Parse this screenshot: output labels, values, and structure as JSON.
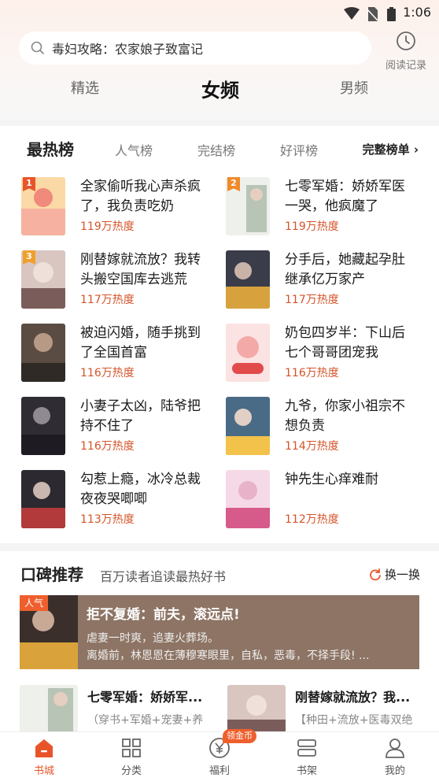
{
  "status_bar": {
    "time": "1:06",
    "icons": [
      "wifi-icon",
      "no-sim-icon",
      "battery-icon"
    ]
  },
  "search": {
    "placeholder": "毒妇攻略：农家娘子致富记",
    "icon": "search-icon"
  },
  "history": {
    "label": "阅读记录",
    "icon": "clock-icon"
  },
  "top_tabs": [
    {
      "label": "精选",
      "active": false
    },
    {
      "label": "女频",
      "active": true
    },
    {
      "label": "男频",
      "active": false
    }
  ],
  "ranking": {
    "title": "最热榜",
    "tabs": [
      "人气榜",
      "完结榜",
      "好评榜"
    ],
    "full_list": "完整榜单 ›",
    "books": [
      {
        "rank": "1",
        "title": "全家偷听我心声杀疯了，我负责吃奶",
        "heat": "119万热度"
      },
      {
        "rank": "2",
        "title": "七零军婚：娇娇军医一哭，他疯魔了",
        "heat": "119万热度"
      },
      {
        "rank": "3",
        "title": "刚替嫁就流放？我转头搬空国库去逃荒",
        "heat": "117万热度"
      },
      {
        "rank": "",
        "title": "分手后，她藏起孕肚继承亿万家产",
        "heat": "117万热度"
      },
      {
        "rank": "",
        "title": "被迫闪婚，随手挑到了全国首富",
        "heat": "116万热度"
      },
      {
        "rank": "",
        "title": "奶包四岁半：下山后七个哥哥团宠我",
        "heat": "116万热度"
      },
      {
        "rank": "",
        "title": "小妻子太凶，陆爷把持不住了",
        "heat": "116万热度"
      },
      {
        "rank": "",
        "title": "九爷，你家小祖宗不想负责",
        "heat": "114万热度"
      },
      {
        "rank": "",
        "title": "勾惹上瘾，冰冷总裁夜夜哭唧唧",
        "heat": "113万热度"
      },
      {
        "rank": "",
        "title": "钟先生心痒难耐",
        "heat": "112万热度"
      }
    ]
  },
  "recommend": {
    "title": "口碑推荐",
    "subtitle": "百万读者追读最热好书",
    "refresh": "换一换",
    "banner": {
      "tag": "人气",
      "title": "拒不复婚：前夫，滚远点!",
      "desc1": "虐妻一时爽，追妻火葬场。",
      "desc2": "离婚前，林恩恩在薄穆寒眼里，自私，恶毒，不择手段! ..."
    },
    "mini_books": [
      {
        "title": "七零军婚：娇娇军...",
        "tags": "（穿书+军婚+宠妻+养"
      },
      {
        "title": "刚替嫁就流放？我...",
        "tags": "【种田+流放+医毒双绝"
      }
    ]
  },
  "tabbar": {
    "coin_badge": "领金币",
    "items": [
      {
        "label": "书城",
        "icon": "bookstore-icon",
        "active": true
      },
      {
        "label": "分类",
        "icon": "category-icon",
        "active": false
      },
      {
        "label": "福利",
        "icon": "yen-coin-icon",
        "active": false
      },
      {
        "label": "书架",
        "icon": "bookshelf-icon",
        "active": false
      },
      {
        "label": "我的",
        "icon": "user-icon",
        "active": false
      }
    ]
  },
  "colors": {
    "accent": "#e8542a",
    "heat": "#d5542a"
  }
}
